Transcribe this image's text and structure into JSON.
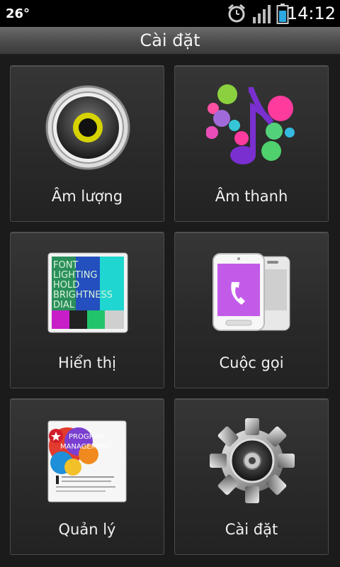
{
  "status": {
    "temperature": "26°",
    "time": "14:12",
    "alarm_icon": "alarm-clock-icon",
    "signal_icon": "signal-bars-icon",
    "battery_icon": "battery-icon"
  },
  "header": {
    "title": "Cài đặt"
  },
  "tiles": [
    {
      "label": "Âm lượng",
      "icon": "speaker-icon"
    },
    {
      "label": "Âm thanh",
      "icon": "music-note-icon"
    },
    {
      "label": "Hiển thị",
      "icon": "display-icon",
      "icon_text": [
        "FONT",
        "LIGHTING",
        "HOLD",
        "BRIGHTNESS",
        "DIAL"
      ]
    },
    {
      "label": "Cuộc gọi",
      "icon": "phone-icon"
    },
    {
      "label": "Quản lý",
      "icon": "program-management-icon",
      "icon_text": [
        "PROGRAM",
        "MANAGEMENT"
      ]
    },
    {
      "label": "Cài đặt",
      "icon": "gear-icon"
    }
  ],
  "colors": {
    "background": "#1b1b1b",
    "titlebar": "#4a4a4a",
    "battery": "#2ea8e0"
  }
}
